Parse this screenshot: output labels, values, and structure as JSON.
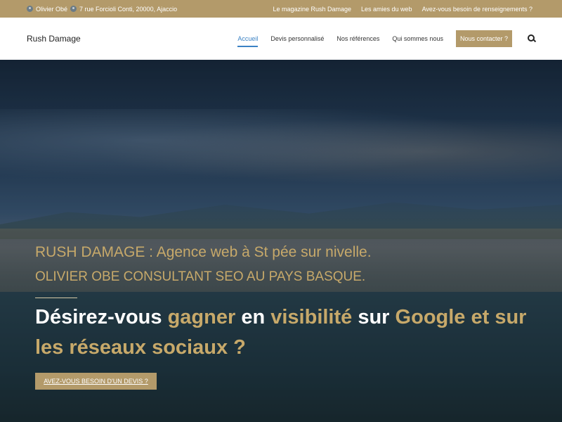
{
  "topbar": {
    "contact_name": "Olivier Obé",
    "contact_address": "7 rue Forcioli Conti, 20000, Ajaccio",
    "links": [
      "Le magazine Rush Damage",
      "Les amies du web",
      "Avez-vous besoin de renseignements ?"
    ]
  },
  "header": {
    "logo": "Rush Damage",
    "nav": [
      "Accueil",
      "Devis personnalisé",
      "Nos références",
      "Qui sommes nous"
    ],
    "cta": "Nous contacter ?"
  },
  "hero": {
    "sub1": "RUSH DAMAGE : Agence web à St pée sur nivelle.",
    "sub2": "OLIVIER OBE CONSULTANT SEO AU PAYS BASQUE.",
    "headline_parts": [
      "Désirez-vous",
      "gagner",
      "en",
      "visibilité",
      "sur",
      "Google et sur les réseaux sociaux ?"
    ],
    "button": "AVEZ-VOUS BESOIN D'UN DEVIS ?"
  },
  "colors": {
    "accent": "#b39a6a",
    "gold_text": "#c7a96a",
    "active_nav": "#3b82c4"
  },
  "icons": [
    "person-icon",
    "location-icon",
    "search-icon"
  ]
}
